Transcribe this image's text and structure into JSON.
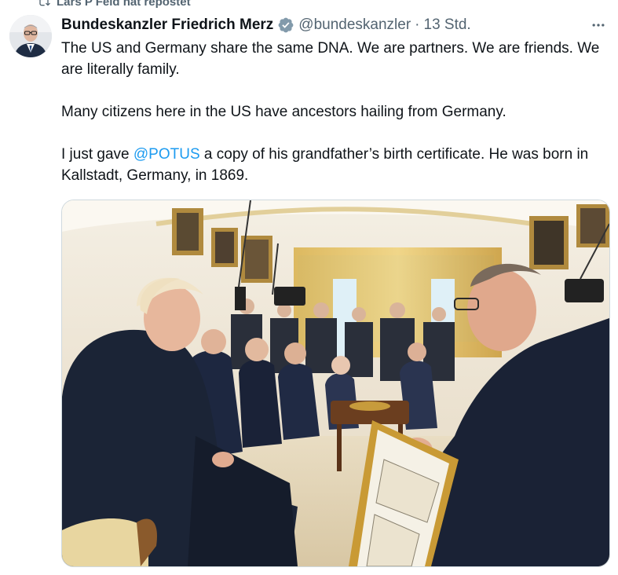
{
  "repost": {
    "label": "Lars P Feld hat repostet",
    "icon": "repost-icon"
  },
  "author": {
    "name": "Bundeskanzler Friedrich Merz",
    "handle": "@bundeskanzler",
    "separator": "·",
    "time": "13 Std.",
    "verified_color": "#829aab",
    "avatar_icon": "avatar"
  },
  "more_icon": "more-options-icon",
  "tweet": {
    "p1": "The US and Germany share the same DNA. We are partners. We are friends. We are literally family.",
    "p2": "Many citizens here in the US have ancestors hailing from Germany.",
    "p3_before": "I just gave ",
    "p3_mention": "@POTUS",
    "p3_after": " a copy of his grandfather’s birth certificate. He was born in Kallstadt, Germany, in 1869."
  },
  "colors": {
    "text": "#0f1419",
    "secondary": "#536471",
    "link": "#1d9bf0",
    "border": "#cfd9de"
  }
}
